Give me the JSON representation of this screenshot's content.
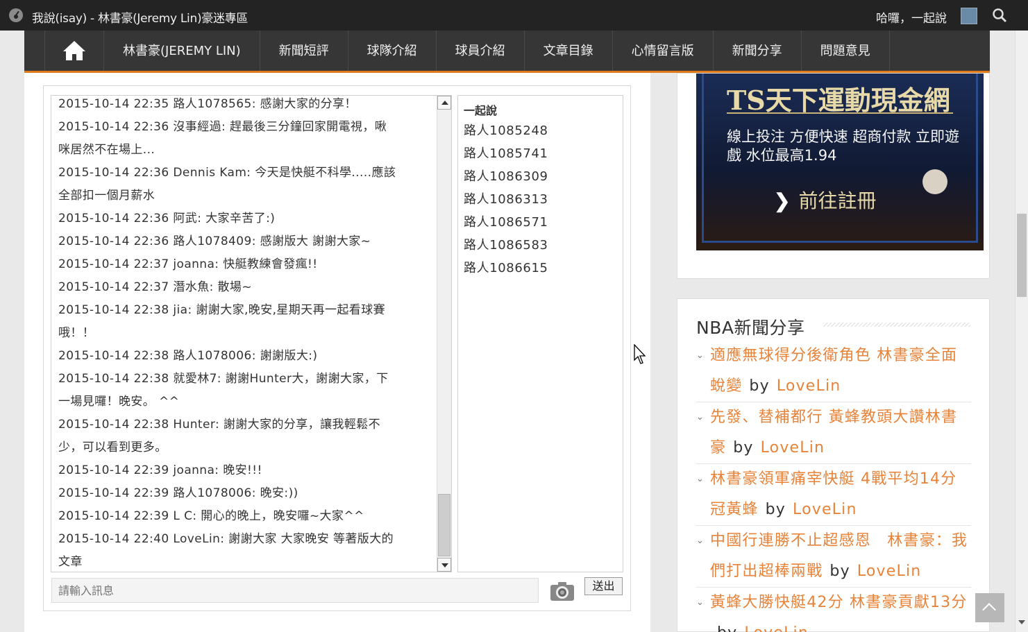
{
  "adminbar": {
    "site_title": "我說(isay) - 林書豪(Jeremy Lin)豪迷專區",
    "greeting": "哈囉，一起說"
  },
  "nav": {
    "items": [
      {
        "label": "林書豪(JEREMY LIN)"
      },
      {
        "label": "新聞短評"
      },
      {
        "label": "球隊介紹"
      },
      {
        "label": "球員介紹"
      },
      {
        "label": "文章目錄"
      },
      {
        "label": "心情留言版"
      },
      {
        "label": "新聞分享"
      },
      {
        "label": "問題意見"
      }
    ]
  },
  "chat": {
    "lines": [
      "2015-10-14 22:35 路人1078565: 感謝大家的分享！",
      "2015-10-14 22:36 沒事經過: 趕最後三分鐘回家開電視，啾",
      "咪居然不在場上...",
      "2015-10-14 22:36 Dennis Kam: 今天是快艇不科學.....應該",
      "全部扣一個月薪水",
      "2015-10-14 22:36 阿武: 大家辛苦了:)",
      "2015-10-14 22:36 路人1078409: 感謝版大 謝謝大家~",
      "2015-10-14 22:37 joanna: 快艇教練會發瘋!!",
      "2015-10-14 22:37 潛水魚: 散場~",
      "2015-10-14 22:38 jia: 謝謝大家,晚安,星期天再一起看球賽",
      "哦！！",
      "2015-10-14 22:38 路人1078006: 謝謝版大:)",
      "2015-10-14 22:38 就愛林7: 謝謝Hunter大，謝謝大家，下",
      "一場見囉！晚安。 ^^",
      "2015-10-14 22:38 Hunter: 謝謝大家的分享，讓我輕鬆不",
      "少，可以看到更多。",
      "2015-10-14 22:39 joanna: 晚安!!!",
      "2015-10-14 22:39 路人1078006: 晚安:))",
      "2015-10-14 22:39 L C: 開心的晚上，晚安囉~大家^^",
      "2015-10-14 22:40 LoveLin: 謝謝大家 大家晚安 等著版大的",
      "文章"
    ],
    "users_heading": "一起說",
    "users": [
      "路人1085248",
      "路人1085741",
      "路人1086309",
      "路人1086313",
      "路人1086571",
      "路人1086583",
      "路人1086615"
    ],
    "input_placeholder": "請輸入訊息",
    "send_label": "送出"
  },
  "ad": {
    "brand_prefix": "TS",
    "brand_rest": "天下運動現金網",
    "text": "線上投注 方便快速 超商付款 立即遊戲 水位最高1.94",
    "cta": "前往註冊"
  },
  "news": {
    "title": "NBA新聞分享",
    "by_label": "by",
    "items": [
      {
        "title": "適應無球得分後衛角色 林書豪全面蛻變",
        "author": "LoveLin"
      },
      {
        "title": "先發、替補都行 黃蜂教頭大讚林書豪",
        "author": "LoveLin"
      },
      {
        "title": "林書豪領軍痛宰快艇 4戰平均14分冠黃蜂",
        "author": "LoveLin"
      },
      {
        "title": "中國行連勝不止超感恩　林書豪：我們打出超棒兩戰",
        "author": "LoveLin"
      },
      {
        "title": "黃蜂大勝快艇42分 林書豪貢獻13分",
        "author": "LoveLin"
      }
    ]
  },
  "colors": {
    "nav_bg": "#363636",
    "nav_accent": "#e07b1a",
    "link": "#e8833a",
    "adminbar_bg": "#232323"
  },
  "icons": [
    "dashboard-icon",
    "avatar-icon",
    "search-icon",
    "home-icon",
    "camera-icon",
    "chevron-down-icon",
    "chevron-up-icon",
    "chevron-right-icon"
  ]
}
